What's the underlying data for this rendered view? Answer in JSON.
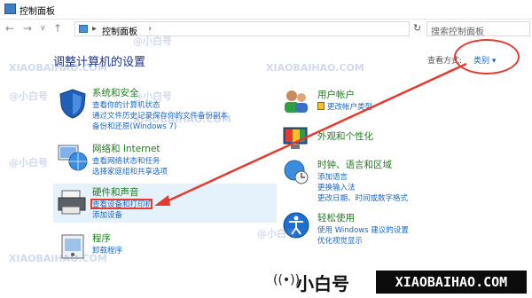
{
  "window": {
    "title": "控制面板"
  },
  "address": {
    "separator": "▸",
    "crumb": "控制面板",
    "chevron": "›"
  },
  "search": {
    "placeholder": "搜索控制面板"
  },
  "heading": "调整计算机的设置",
  "viewby": {
    "label": "查看方式:",
    "value": "类别 ▾"
  },
  "left_categories": [
    {
      "title": "系统和安全",
      "links": [
        "查看你的计算机状态",
        "通过文件历史记录保存你的文件备份副本",
        "备份和还原(Windows 7)"
      ]
    },
    {
      "title": "网络和 Internet",
      "links": [
        "查看网络状态和任务",
        "选择家庭组和共享选项"
      ]
    },
    {
      "title": "硬件和声音",
      "links": [
        "查看设备和打印机",
        "添加设备"
      ]
    },
    {
      "title": "程序",
      "links": [
        "卸载程序"
      ]
    }
  ],
  "right_categories": [
    {
      "title": "用户帐户",
      "links": [
        "更改帐户类型"
      ]
    },
    {
      "title": "外观和个性化",
      "links": []
    },
    {
      "title": "时钟、语言和区域",
      "links": [
        "添加语言",
        "更换输入法",
        "更改日期、时间或数字格式"
      ]
    },
    {
      "title": "轻松使用",
      "links": [
        "使用 Windows 建议的设置",
        "优化视觉显示"
      ]
    }
  ],
  "watermark": {
    "handle": "@小白号",
    "domain": "XIAOBAIHAO.COM"
  },
  "brand": {
    "icon": "((•))",
    "cn": "小白号",
    "en": "XIAOBAIHAO.COM"
  },
  "colors": {
    "category_title": "#217a1f",
    "link": "#1a66c9",
    "heading": "#1e3287",
    "annotation": "#e33b2f"
  }
}
